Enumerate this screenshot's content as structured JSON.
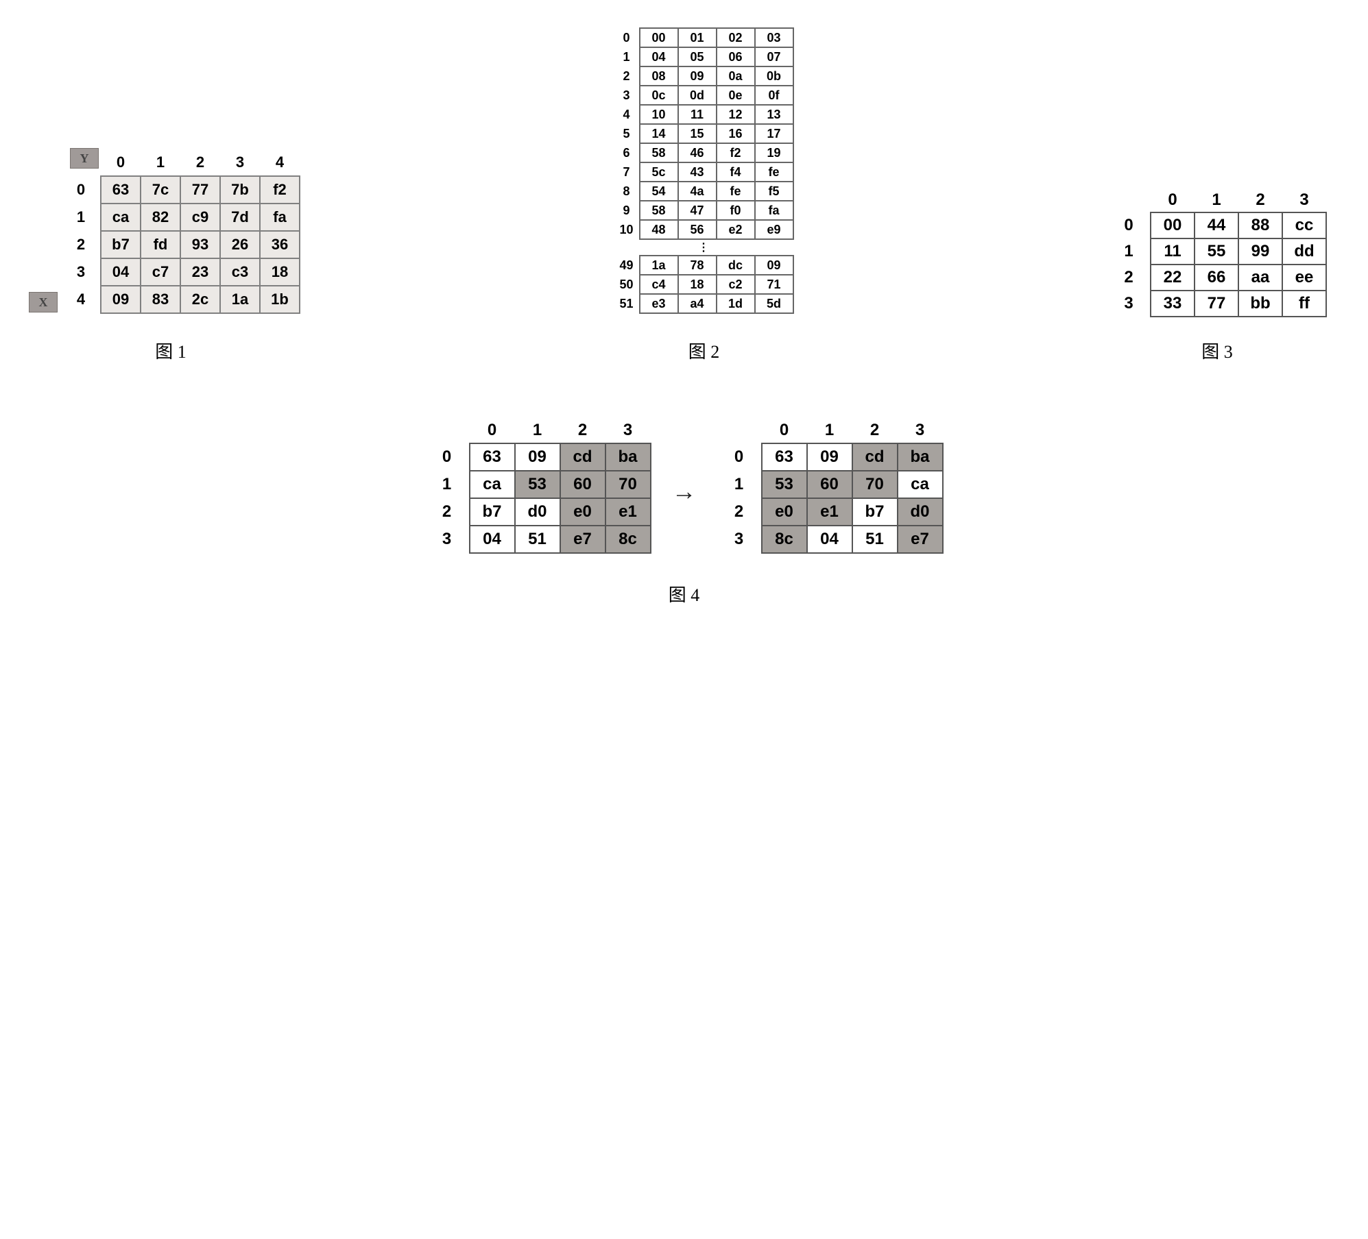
{
  "fig1": {
    "yBadge": "Y",
    "xBadge": "X",
    "colHeaders": [
      "0",
      "1",
      "2",
      "3",
      "4"
    ],
    "rows": [
      {
        "h": "0",
        "c": [
          "63",
          "7c",
          "77",
          "7b",
          "f2"
        ]
      },
      {
        "h": "1",
        "c": [
          "ca",
          "82",
          "c9",
          "7d",
          "fa"
        ]
      },
      {
        "h": "2",
        "c": [
          "b7",
          "fd",
          "93",
          "26",
          "36"
        ]
      },
      {
        "h": "3",
        "c": [
          "04",
          "c7",
          "23",
          "c3",
          "18"
        ]
      },
      {
        "h": "4",
        "c": [
          "09",
          "83",
          "2c",
          "1a",
          "1b"
        ]
      }
    ],
    "caption": "图 1"
  },
  "fig2": {
    "rowsA": [
      {
        "h": "0",
        "c": [
          "00",
          "01",
          "02",
          "03"
        ]
      },
      {
        "h": "1",
        "c": [
          "04",
          "05",
          "06",
          "07"
        ]
      },
      {
        "h": "2",
        "c": [
          "08",
          "09",
          "0a",
          "0b"
        ]
      },
      {
        "h": "3",
        "c": [
          "0c",
          "0d",
          "0e",
          "0f"
        ]
      },
      {
        "h": "4",
        "c": [
          "10",
          "11",
          "12",
          "13"
        ]
      },
      {
        "h": "5",
        "c": [
          "14",
          "15",
          "16",
          "17"
        ]
      },
      {
        "h": "6",
        "c": [
          "58",
          "46",
          "f2",
          "19"
        ]
      },
      {
        "h": "7",
        "c": [
          "5c",
          "43",
          "f4",
          "fe"
        ]
      },
      {
        "h": "8",
        "c": [
          "54",
          "4a",
          "fe",
          "f5"
        ]
      },
      {
        "h": "9",
        "c": [
          "58",
          "47",
          "f0",
          "fa"
        ]
      },
      {
        "h": "10",
        "c": [
          "48",
          "56",
          "e2",
          "e9"
        ]
      }
    ],
    "rowsB": [
      {
        "h": "49",
        "c": [
          "1a",
          "78",
          "dc",
          "09"
        ]
      },
      {
        "h": "50",
        "c": [
          "c4",
          "18",
          "c2",
          "71"
        ]
      },
      {
        "h": "51",
        "c": [
          "e3",
          "a4",
          "1d",
          "5d"
        ]
      }
    ],
    "ellipsis": "⋮",
    "caption": "图 2"
  },
  "fig3": {
    "colHeaders": [
      "0",
      "1",
      "2",
      "3"
    ],
    "rows": [
      {
        "h": "0",
        "c": [
          "00",
          "44",
          "88",
          "cc"
        ]
      },
      {
        "h": "1",
        "c": [
          "11",
          "55",
          "99",
          "dd"
        ]
      },
      {
        "h": "2",
        "c": [
          "22",
          "66",
          "aa",
          "ee"
        ]
      },
      {
        "h": "3",
        "c": [
          "33",
          "77",
          "bb",
          "ff"
        ]
      }
    ],
    "caption": "图 3"
  },
  "fig4": {
    "colHeaders": [
      "0",
      "1",
      "2",
      "3"
    ],
    "left": [
      {
        "h": "0",
        "c": [
          "63",
          "09",
          "cd",
          "ba"
        ],
        "sh": [
          0,
          0,
          1,
          1
        ]
      },
      {
        "h": "1",
        "c": [
          "ca",
          "53",
          "60",
          "70"
        ],
        "sh": [
          0,
          1,
          1,
          1
        ]
      },
      {
        "h": "2",
        "c": [
          "b7",
          "d0",
          "e0",
          "e1"
        ],
        "sh": [
          0,
          0,
          1,
          1
        ]
      },
      {
        "h": "3",
        "c": [
          "04",
          "51",
          "e7",
          "8c"
        ],
        "sh": [
          0,
          0,
          1,
          1
        ]
      }
    ],
    "right": [
      {
        "h": "0",
        "c": [
          "63",
          "09",
          "cd",
          "ba"
        ],
        "sh": [
          0,
          0,
          1,
          1
        ]
      },
      {
        "h": "1",
        "c": [
          "53",
          "60",
          "70",
          "ca"
        ],
        "sh": [
          1,
          1,
          1,
          0
        ]
      },
      {
        "h": "2",
        "c": [
          "e0",
          "e1",
          "b7",
          "d0"
        ],
        "sh": [
          1,
          1,
          0,
          1
        ]
      },
      {
        "h": "3",
        "c": [
          "8c",
          "04",
          "51",
          "e7"
        ],
        "sh": [
          1,
          0,
          0,
          1
        ]
      }
    ],
    "arrow": "→",
    "caption": "图 4"
  }
}
